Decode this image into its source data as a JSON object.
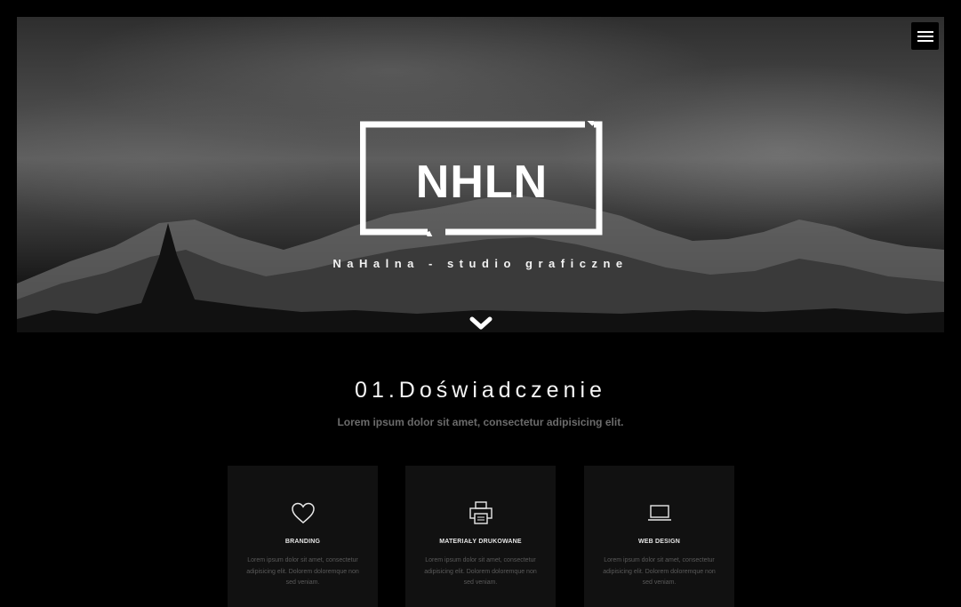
{
  "menu": {
    "icon": "hamburger-menu-icon"
  },
  "hero": {
    "logo_text": "NHLN",
    "tagline": "NaHalna - studio graficzne",
    "scroll_icon": "chevron-down-icon"
  },
  "section": {
    "title": "01.Doświadczenie",
    "subtitle": "Lorem ipsum dolor sit amet, consectetur adipisicing elit."
  },
  "cards": [
    {
      "icon": "heart-icon",
      "title": "BRANDING",
      "text": "Lorem ipsum dolor sit amet, consectetur adipisicing elit. Dolorem doloremque non sed veniam."
    },
    {
      "icon": "printer-icon",
      "title": "MATERIAŁY DRUKOWANE",
      "text": "Lorem ipsum dolor sit amet, consectetur adipisicing elit. Dolorem doloremque non sed veniam."
    },
    {
      "icon": "laptop-icon",
      "title": "WEB DESIGN",
      "text": "Lorem ipsum dolor sit amet, consectetur adipisicing elit. Dolorem doloremque non sed veniam."
    }
  ]
}
